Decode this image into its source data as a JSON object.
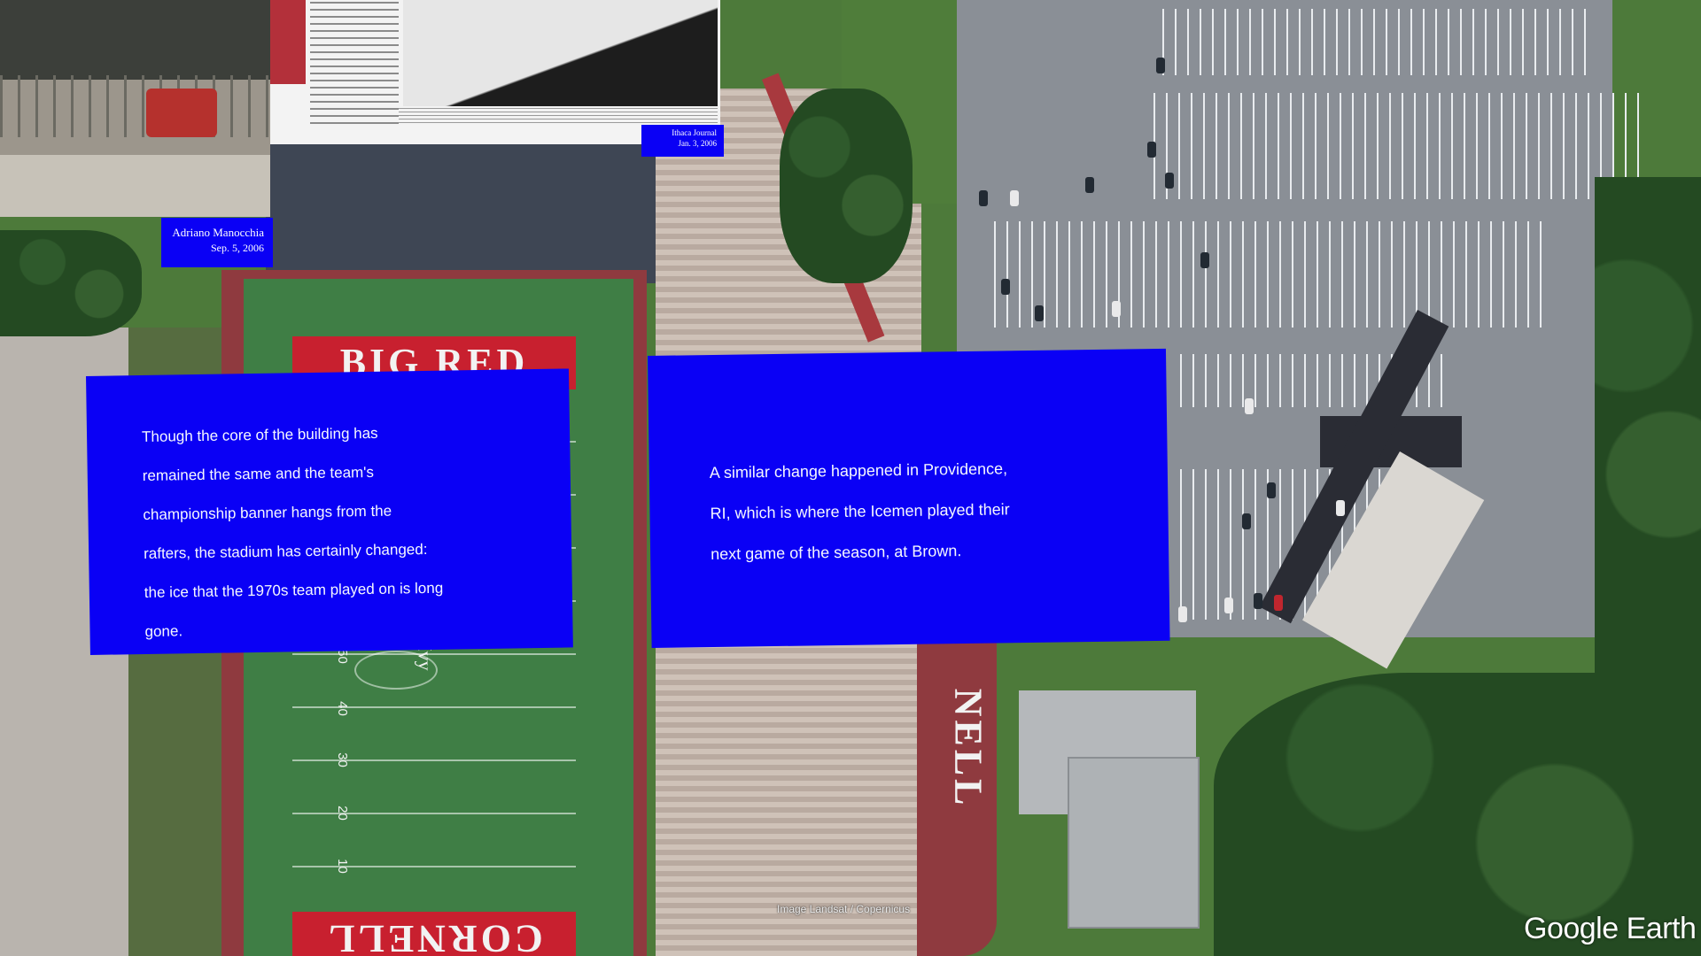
{
  "overlays": {
    "caption_left": {
      "lines": [
        "Though the core of the building has",
        "remained the same and the team's",
        "championship banner hangs from the",
        "rafters, the stadium has certainly changed:",
        "the ice that the 1970s team played on is long",
        "gone."
      ]
    },
    "caption_right": {
      "lines": [
        "A similar change happened in Providence,",
        "RI, which is where the Icemen played their",
        "next game of the season, at Brown."
      ]
    },
    "photo_credit": {
      "name": "Adriano Manocchia",
      "date": "Sep. 5, 2006"
    },
    "clipping_credit": {
      "name": "Ithaca Journal",
      "date": "Jan. 3, 2006"
    }
  },
  "map": {
    "field_text_top": "BIG RED",
    "field_text_bottom": "CORNELL",
    "stands_text": "NELL",
    "field_logo": "Ivy",
    "yard_numbers": [
      "50",
      "40",
      "30",
      "20",
      "10"
    ],
    "imagery_credit": "Image Landsat / Copernicus",
    "watermark": "Google Earth"
  },
  "colors": {
    "overlay_blue": "#0a00f5",
    "field_green": "#3f7e45",
    "cornell_red": "#c8202f"
  },
  "icons": {
    "map": "satellite-imagery"
  }
}
